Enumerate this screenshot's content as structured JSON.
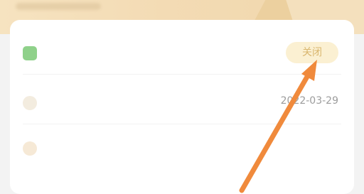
{
  "banner": {
    "subtitle": ""
  },
  "settings": [
    {
      "label": "",
      "control": "关闭",
      "icon": "toggle-icon",
      "icon_color": "#8fd18a"
    },
    {
      "label": "",
      "value": "2022-03-29",
      "icon": "calendar-icon",
      "icon_color": "#f3ecdf"
    },
    {
      "label": "",
      "value": "",
      "icon": "info-icon",
      "icon_color": "#f6e9d6"
    }
  ],
  "colors": {
    "accent": "#f08a3c",
    "button_bg": "#fbf0d2",
    "button_text": "#d9b66e"
  }
}
